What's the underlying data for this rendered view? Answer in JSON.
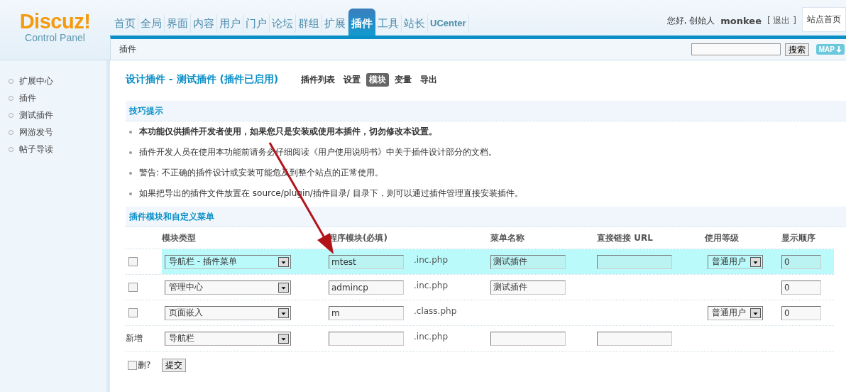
{
  "header": {
    "logo": {
      "name": "Discuz!",
      "subtitle": "Control Panel"
    },
    "nav": [
      {
        "label": "首页",
        "selected": false
      },
      {
        "label": "全局",
        "selected": false
      },
      {
        "label": "界面",
        "selected": false
      },
      {
        "label": "内容",
        "selected": false
      },
      {
        "label": "用户",
        "selected": false
      },
      {
        "label": "门户",
        "selected": false
      },
      {
        "label": "论坛",
        "selected": false
      },
      {
        "label": "群组",
        "selected": false
      },
      {
        "label": "扩展",
        "selected": false
      },
      {
        "label": "插件",
        "selected": true
      },
      {
        "label": "工具",
        "selected": false
      },
      {
        "label": "站长",
        "selected": false
      },
      {
        "label": "UCenter",
        "selected": false
      }
    ],
    "greeting": "您好, 创始人",
    "user": "monkee",
    "logout": "[ 退出 ]",
    "site_home": "站点首页"
  },
  "toolbar": {
    "breadcrumb": "插件",
    "search_button": "搜索",
    "map_button": "MAP"
  },
  "sidebar": {
    "items": [
      {
        "label": "扩展中心"
      },
      {
        "label": "插件"
      },
      {
        "label": "测试插件"
      },
      {
        "label": "网游发号"
      },
      {
        "label": "帖子导读"
      }
    ]
  },
  "page": {
    "title": "设计插件 - 测试插件 (插件已启用)",
    "tabs": [
      {
        "label": "插件列表",
        "selected": false
      },
      {
        "label": "设置",
        "selected": false
      },
      {
        "label": "模块",
        "selected": true
      },
      {
        "label": "变量",
        "selected": false
      },
      {
        "label": "导出",
        "selected": false
      }
    ]
  },
  "tips": {
    "title": "技巧提示",
    "items": [
      {
        "text": "本功能仅供插件开发者使用，如果您只是安装或使用本插件，切勿修改本设置。",
        "bold": true
      },
      {
        "text": "插件开发人员在使用本功能前请务必仔细阅读《用户使用说明书》中关于插件设计部分的文档。",
        "bold": false
      },
      {
        "text": "警告: 不正确的插件设计或安装可能危及到整个站点的正常使用。",
        "bold": false
      },
      {
        "text": "如果把导出的插件文件放置在 source/plugin/插件目录/ 目录下，则可以通过插件管理直接安装插件。",
        "bold": false
      }
    ]
  },
  "modules": {
    "title": "插件模块和自定义菜单",
    "columns": [
      "模块类型",
      "程序模块(必填)",
      "菜单名称",
      "直接链接 URL",
      "使用等级",
      "显示顺序"
    ],
    "rows": [
      {
        "kind": "existing",
        "checked": false,
        "highlighted": true,
        "type": "导航栏 - 插件菜单",
        "module": "mtest",
        "suffix": ".inc.php",
        "menu_name_field": true,
        "menu_name": "测试插件",
        "url_field": true,
        "level_field": true,
        "level": "普通用户",
        "order_field": true,
        "order": "0"
      },
      {
        "kind": "existing",
        "checked": false,
        "highlighted": false,
        "type": "管理中心",
        "module": "admincp",
        "suffix": ".inc.php",
        "menu_name_field": true,
        "menu_name": "测试插件",
        "url_field": false,
        "level_field": false,
        "order_field": true,
        "order": "0"
      },
      {
        "kind": "existing",
        "checked": false,
        "highlighted": false,
        "type": "页面嵌入",
        "module": "m",
        "suffix": ".class.php",
        "menu_name_field": false,
        "url_field": false,
        "level_field": true,
        "level": "普通用户",
        "order_field": true,
        "order": "0"
      },
      {
        "kind": "new",
        "label": "新增",
        "highlighted": false,
        "type": "导航栏",
        "suffix": ".inc.php",
        "menu_name_field": true,
        "url_field": true,
        "level_field": false,
        "order_field": false
      }
    ],
    "footer": {
      "delete_label": "删?",
      "delete_checked": false,
      "submit": "提交"
    }
  }
}
